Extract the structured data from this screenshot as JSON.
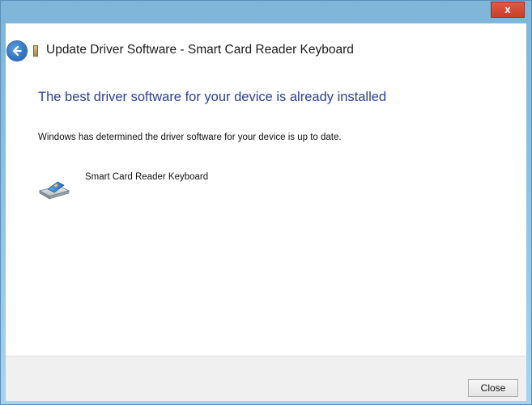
{
  "window": {
    "close_glyph": "x",
    "close_color": "#d9472f",
    "frame_color": "#8bc0e0"
  },
  "header": {
    "back_icon": "back-arrow-icon",
    "device_icon": "smart-card-reader-icon",
    "title": "Update Driver Software - Smart Card Reader Keyboard"
  },
  "main": {
    "heading": "The best driver software for your device is already installed",
    "heading_color": "#2a3f9a",
    "description": "Windows has determined the driver software for your device is up to date.",
    "device": {
      "icon": "smart-card-reader-icon",
      "name": "Smart Card Reader Keyboard"
    }
  },
  "footer": {
    "close_label": "Close"
  }
}
